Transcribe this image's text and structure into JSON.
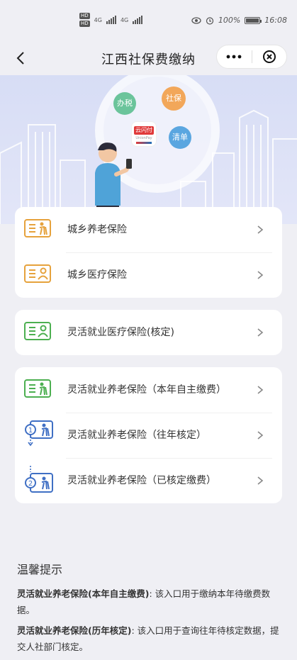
{
  "status_bar": {
    "sim1": "HD",
    "sim2": "HD",
    "net1": "4G",
    "net2": "4G",
    "battery": "100%",
    "time": "16:08"
  },
  "nav": {
    "title": "江西社保费缴纳",
    "back_icon": "chevron-left-icon",
    "more_icon": "more-dots-icon",
    "close_icon": "close-circle-icon"
  },
  "banner": {
    "bubbles": [
      "办税",
      "社保",
      "云闪付",
      "清单"
    ],
    "pay_logo_sub": "UnionPay"
  },
  "cards": [
    {
      "rows": [
        {
          "label": "城乡养老保险",
          "icon": "elderly-doc-icon",
          "color": "#e6a23c"
        },
        {
          "label": "城乡医疗保险",
          "icon": "person-doc-icon",
          "color": "#e6a23c"
        }
      ]
    },
    {
      "rows": [
        {
          "label": "灵活就业医疗保险(核定)",
          "icon": "person-doc-icon",
          "color": "#4caf50"
        }
      ]
    },
    {
      "rows": [
        {
          "label": "灵活就业养老保险（本年自主缴费）",
          "icon": "elderly-doc-icon",
          "color": "#4caf50"
        },
        {
          "label": "灵活就业养老保险（往年核定）",
          "icon": "step1-elderly-icon",
          "color": "#3f6fc4"
        },
        {
          "label": "灵活就业养老保险（已核定缴费）",
          "icon": "step2-elderly-icon",
          "color": "#3f6fc4"
        }
      ]
    }
  ],
  "tips": {
    "title": "温馨提示",
    "items": [
      {
        "bold": "灵活就业养老保险(本年自主缴费)",
        "text": ": 该入口用于缴纳本年待缴费数据。"
      },
      {
        "bold": "灵活就业养老保险(历年核定)",
        "text": ": 该入口用于查询往年待核定数据，提交人社部门核定。"
      }
    ]
  }
}
